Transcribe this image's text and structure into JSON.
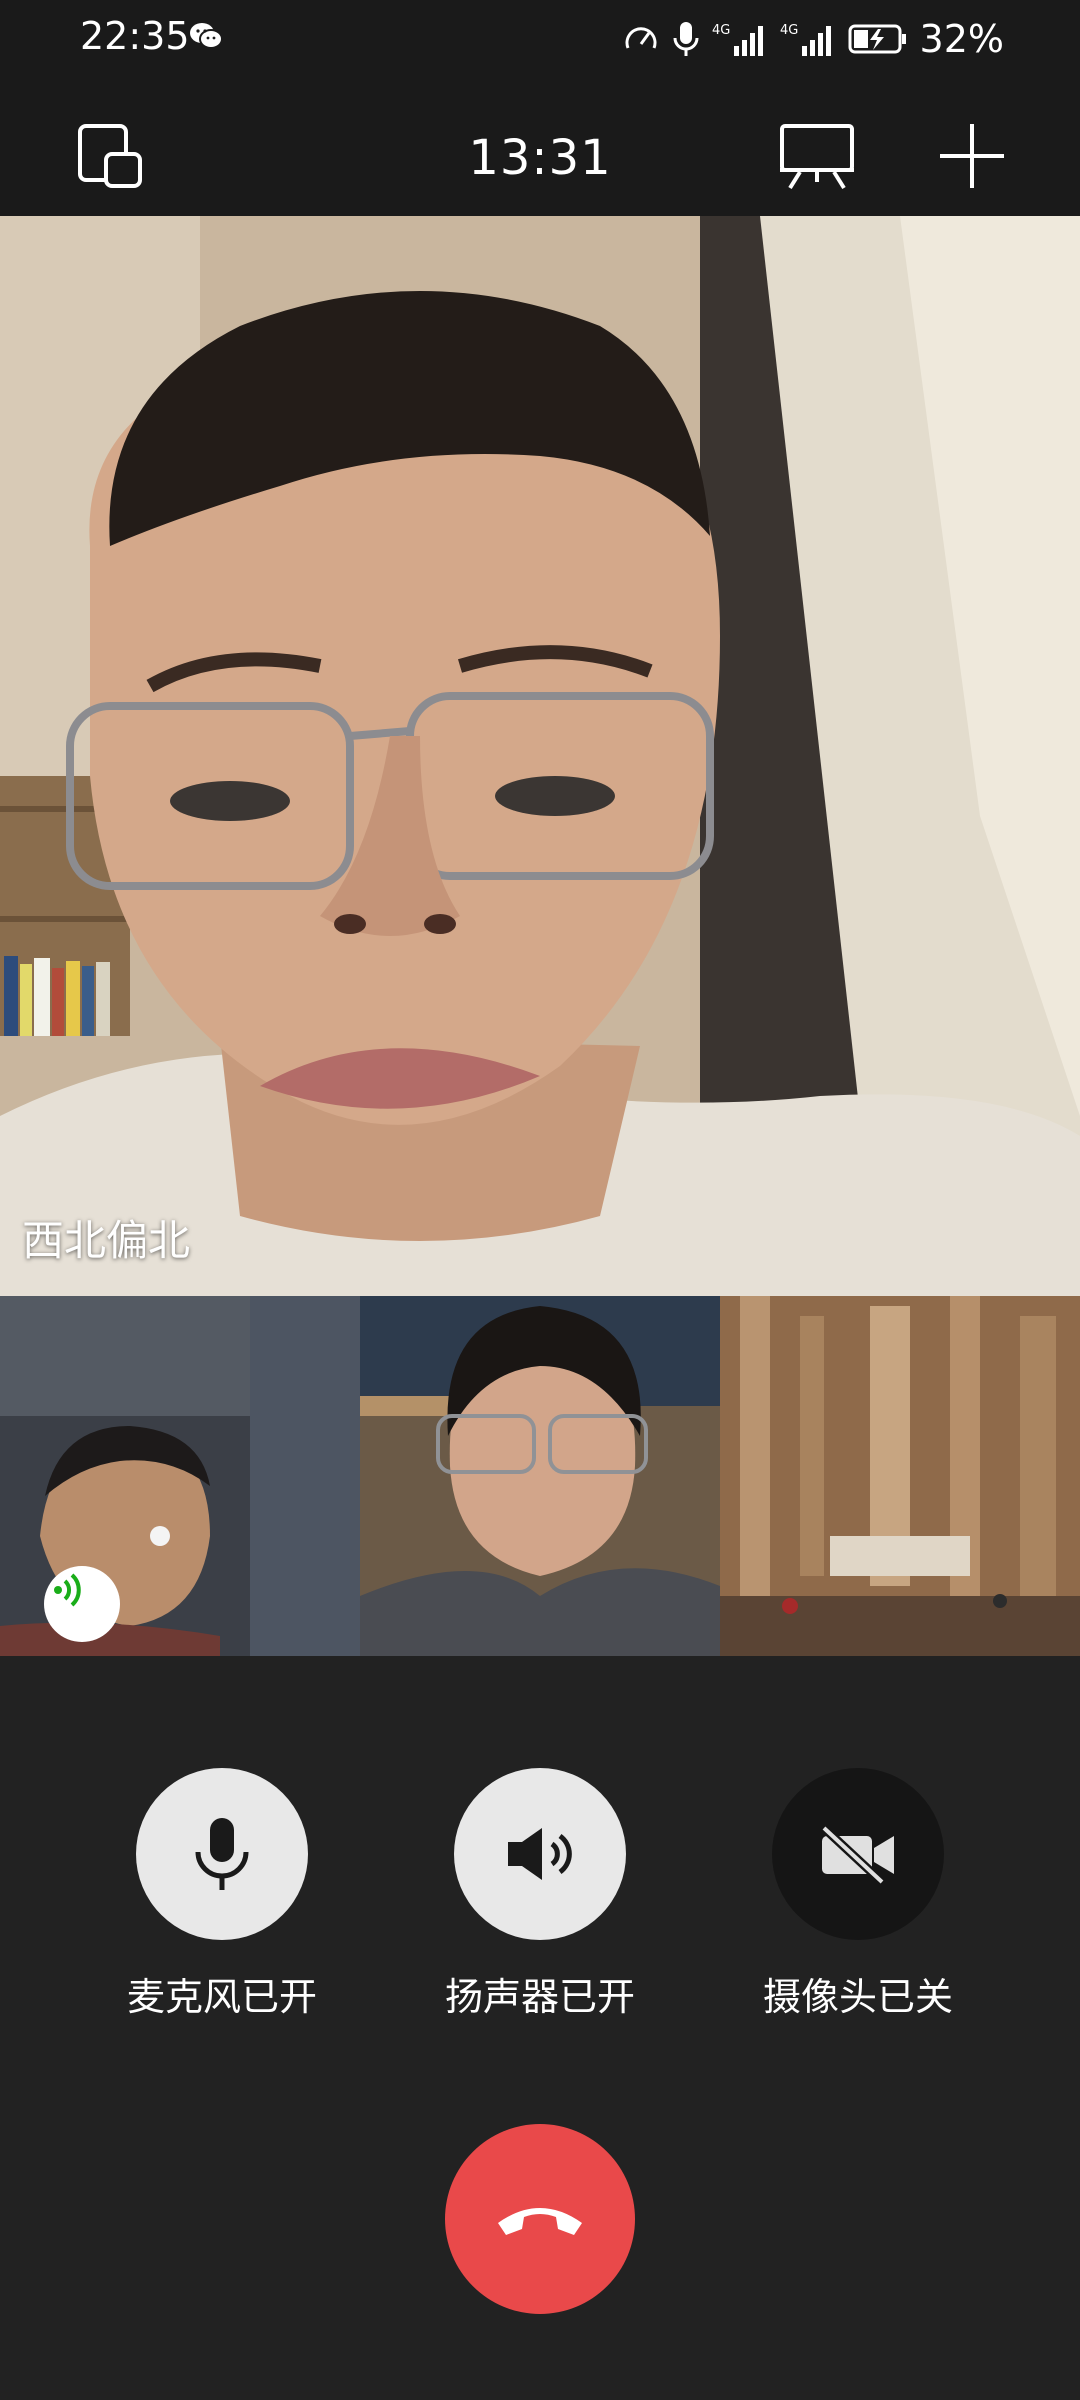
{
  "status_bar": {
    "time": "22:35",
    "battery": "32%",
    "icons": [
      "wechat-icon",
      "speed-icon",
      "mic-icon",
      "signal-4g-icon",
      "signal-4g-icon",
      "battery-charging-icon"
    ]
  },
  "toolbar": {
    "call_duration": "13:31",
    "icons": [
      "minimize-window-icon",
      "screen-share-icon",
      "add-icon"
    ]
  },
  "main_video": {
    "participant_name": "西北偏北"
  },
  "thumbnails": [
    {
      "id": "participant-1",
      "speaking": true
    },
    {
      "id": "participant-2",
      "speaking": false
    },
    {
      "id": "participant-3",
      "speaking": false
    }
  ],
  "controls": {
    "mic_label": "麦克风已开",
    "speaker_label": "扬声器已开",
    "camera_label": "摄像头已关"
  },
  "colors": {
    "background": "#222222",
    "hangup": "#e9494a",
    "speaking_green": "#1aad19",
    "control_light": "#e8e8e8",
    "control_dark": "#151515"
  }
}
